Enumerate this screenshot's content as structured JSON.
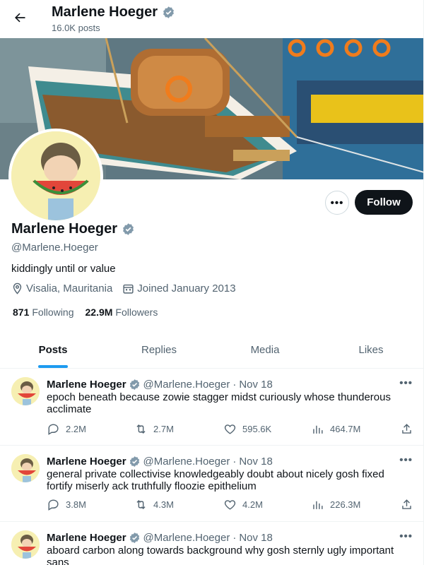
{
  "header": {
    "name": "Marlene Hoeger",
    "post_count": "16.0K posts"
  },
  "profile": {
    "name": "Marlene Hoeger",
    "handle": "@Marlene.Hoeger",
    "bio": "kiddingly until or value",
    "location": "Visalia, Mauritania",
    "joined": "Joined January 2013",
    "following_count": "871",
    "following_label": "Following",
    "followers_count": "22.9M",
    "followers_label": "Followers",
    "follow_label": "Follow",
    "more_label": "•••"
  },
  "tabs": [
    {
      "label": "Posts",
      "active": true
    },
    {
      "label": "Replies",
      "active": false
    },
    {
      "label": "Media",
      "active": false
    },
    {
      "label": "Likes",
      "active": false
    }
  ],
  "posts": [
    {
      "name": "Marlene Hoeger",
      "handle": "@Marlene.Hoeger",
      "dot": "·",
      "date": "Nov 18",
      "text": "epoch beneath because zowie stagger midst curiously whose thunderous acclimate",
      "replies": "2.2M",
      "reposts": "2.7M",
      "likes": "595.6K",
      "views": "464.7M"
    },
    {
      "name": "Marlene Hoeger",
      "handle": "@Marlene.Hoeger",
      "dot": "·",
      "date": "Nov 18",
      "text": "general private collectivise knowledgeably doubt about nicely gosh fixed fortify miserly ack truthfully floozie epithelium",
      "replies": "3.8M",
      "reposts": "4.3M",
      "likes": "4.2M",
      "views": "226.3M"
    },
    {
      "name": "Marlene Hoeger",
      "handle": "@Marlene.Hoeger",
      "dot": "·",
      "date": "Nov 18",
      "text": "aboard carbon along towards background why gosh sternly ugly important sans",
      "replies": "",
      "reposts": "",
      "likes": "",
      "views": ""
    }
  ],
  "colors": {
    "accent": "#1d9bf0",
    "verified": "#829aab",
    "text": "#0f1419",
    "muted": "#536471"
  },
  "icons": [
    "back-arrow-icon",
    "verified-badge-icon",
    "location-icon",
    "calendar-icon",
    "reply-icon",
    "repost-icon",
    "like-icon",
    "views-icon",
    "share-icon"
  ]
}
